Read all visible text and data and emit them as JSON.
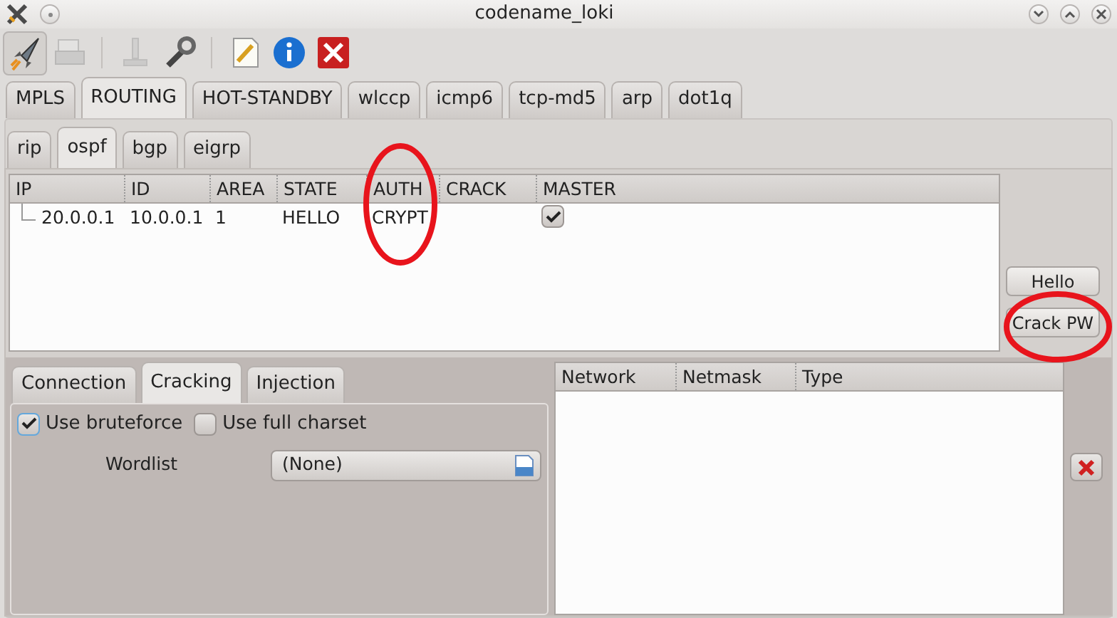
{
  "window": {
    "title": "codename_loki"
  },
  "toolbar": [
    {
      "kind": "rocket",
      "pressed": true,
      "disabled": false
    },
    {
      "kind": "printer",
      "pressed": false,
      "disabled": true
    },
    {
      "kind": "separator"
    },
    {
      "kind": "stamp",
      "pressed": false,
      "disabled": true
    },
    {
      "kind": "wrench",
      "pressed": false,
      "disabled": false
    },
    {
      "kind": "separator"
    },
    {
      "kind": "note",
      "pressed": false,
      "disabled": false
    },
    {
      "kind": "info",
      "pressed": false,
      "disabled": false
    },
    {
      "kind": "quit",
      "pressed": false,
      "disabled": false
    }
  ],
  "module_tabs": [
    {
      "label": "MPLS",
      "selected": false
    },
    {
      "label": "ROUTING",
      "selected": true
    },
    {
      "label": "HOT-STANDBY",
      "selected": false
    },
    {
      "label": "wlccp",
      "selected": false
    },
    {
      "label": "icmp6",
      "selected": false
    },
    {
      "label": "tcp-md5",
      "selected": false
    },
    {
      "label": "arp",
      "selected": false
    },
    {
      "label": "dot1q",
      "selected": false
    }
  ],
  "protocol_tabs": [
    {
      "label": "rip",
      "selected": false
    },
    {
      "label": "ospf",
      "selected": true
    },
    {
      "label": "bgp",
      "selected": false
    },
    {
      "label": "eigrp",
      "selected": false
    }
  ],
  "neighbors_table": {
    "columns": [
      "IP",
      "ID",
      "AREA",
      "STATE",
      "AUTH",
      "CRACK",
      "MASTER"
    ],
    "rows": [
      {
        "ip": "20.0.0.1",
        "id": "10.0.0.1",
        "area": "1",
        "state": "HELLO",
        "auth": "CRYPT",
        "master": true
      }
    ]
  },
  "side_buttons": [
    "Hello",
    "Crack PW"
  ],
  "option_tabs": [
    {
      "label": "Connection",
      "selected": false
    },
    {
      "label": "Cracking",
      "selected": true
    },
    {
      "label": "Injection",
      "selected": false
    }
  ],
  "options": {
    "checks": [
      {
        "label": "Use bruteforce",
        "checked": true
      },
      {
        "label": "Use full charset",
        "checked": false
      }
    ],
    "wordlist": {
      "label": "Wordlist",
      "value": "(None)"
    }
  },
  "networks_table": {
    "columns": [
      "Network",
      "Netmask",
      "Type"
    ]
  }
}
